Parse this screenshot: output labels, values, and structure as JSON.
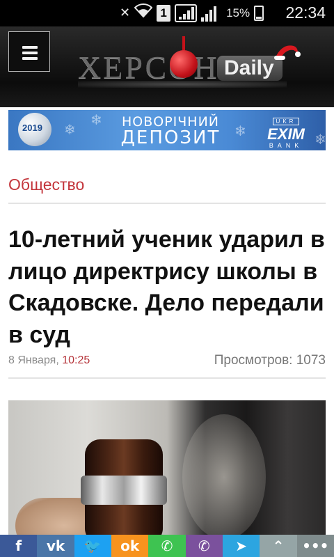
{
  "status_bar": {
    "battery_percent": "15%",
    "time": "22:34",
    "sim_slot": "1",
    "icons": [
      "mute-vibrate-icon",
      "wifi-icon",
      "sim-icon",
      "signal-icon",
      "signal-icon",
      "battery-icon"
    ]
  },
  "header": {
    "logo": {
      "city": "ХЕРСОН",
      "brand": "Daily"
    },
    "menu_icon": "hamburger-icon"
  },
  "banner_ad": {
    "year": "2019",
    "title_line1": "НОВОРІЧНИЙ",
    "title_line2": "ДЕПОЗИТ",
    "bank_top": "UKR",
    "bank_main": "EXIM",
    "bank_bottom": "BANK",
    "colors": {
      "background": "#4a8ad5",
      "text": "#ffffff"
    }
  },
  "article": {
    "category": "Общество",
    "title": "10-летний ученик ударил в лицо директрису школы в Скадовске. Дело передали в суд",
    "date": "8 Января,",
    "time": "10:25",
    "views": "Просмотров: 1073"
  },
  "share_bar": {
    "buttons": [
      {
        "name": "facebook",
        "glyph": "f",
        "color": "#3b5998"
      },
      {
        "name": "vk",
        "glyph": "vk",
        "color": "#4a76a8"
      },
      {
        "name": "twitter",
        "glyph": "🐦",
        "color": "#1da1f2"
      },
      {
        "name": "odnoklassniki",
        "glyph": "ok",
        "color": "#f7931e"
      },
      {
        "name": "whatsapp",
        "glyph": "✆",
        "color": "#3ec351"
      },
      {
        "name": "viber",
        "glyph": "✆",
        "color": "#7b519d"
      },
      {
        "name": "telegram",
        "glyph": "➤",
        "color": "#2ca5e0"
      },
      {
        "name": "scroll-up",
        "glyph": "⌃",
        "color": "#95a5a6"
      },
      {
        "name": "more",
        "glyph": "•••",
        "color": "#7f8c8d"
      }
    ]
  },
  "colors": {
    "accent": "#c3353b",
    "header_bg": "#111111"
  }
}
